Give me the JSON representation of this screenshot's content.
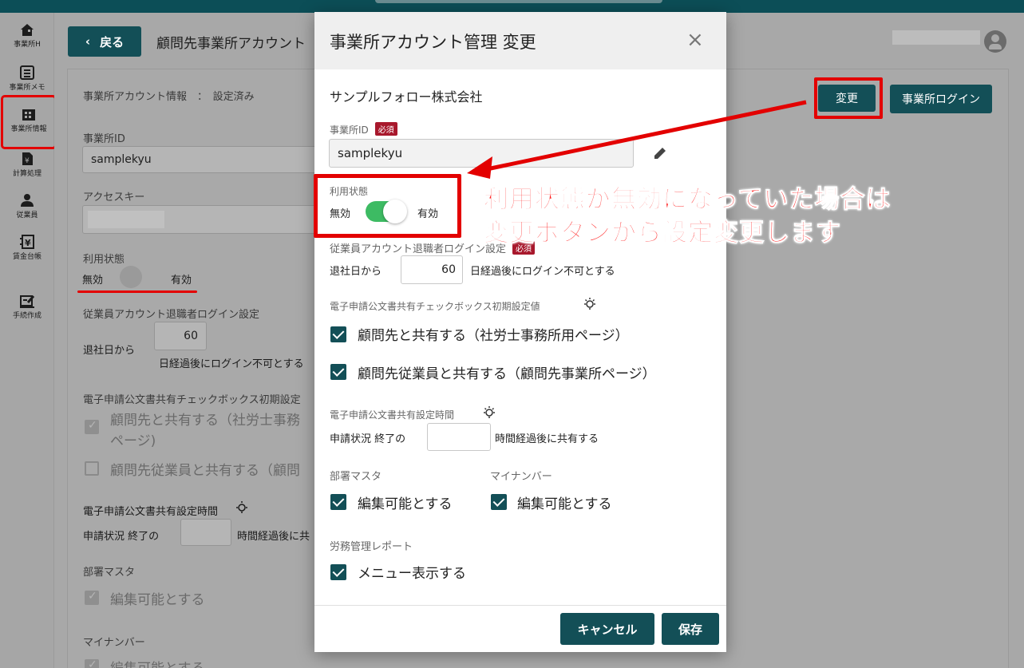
{
  "sidebar": {
    "items": [
      {
        "label": "事業所H",
        "icon": "home-icon"
      },
      {
        "label": "事業所メモ",
        "icon": "memo-icon"
      },
      {
        "label": "事業所情報",
        "icon": "office-building-icon"
      },
      {
        "label": "計算処理",
        "icon": "calculation-doc-icon"
      },
      {
        "label": "従業員",
        "icon": "person-icon"
      },
      {
        "label": "賃金台帳",
        "icon": "yen-ledger-icon"
      },
      {
        "label": "手続作成",
        "icon": "edit-form-icon"
      }
    ]
  },
  "header": {
    "back_label": "戻る",
    "page_title": "顧問先事業所アカウント"
  },
  "background": {
    "account_info_label": "事業所アカウント情報",
    "account_info_sep": "：",
    "account_info_value": "設定済み",
    "office_id_label": "事業所ID",
    "office_id_value": "samplekyu",
    "access_key_label": "アクセスキー",
    "status_label": "利用状態",
    "status_off": "無効",
    "status_on": "有効",
    "retire_label": "従業員アカウント退職者ログイン設定",
    "retire_prefix": "退社日から",
    "retire_days": "60",
    "retire_suffix": "日経過後にログイン不可とする",
    "share_default_label": "電子申請公文書共有チェックボックス初期設定",
    "share_client_line1": "顧問先と共有する（社労士事務",
    "share_client_line2": "ページ)",
    "share_employee": "顧問先従業員と共有する（顧問",
    "share_time_label": "電子申請公文書共有設定時間",
    "share_time_prefix": "申請状況 終了の",
    "share_time_suffix": "時間経過後に共",
    "dept_label": "部署マスタ",
    "dept_editable": "編集可能とする",
    "mynumber_label": "マイナンバー",
    "mynumber_editable": "編集可能とする",
    "change_button": "変更",
    "login_button": "事業所ログイン"
  },
  "modal": {
    "title": "事業所アカウント管理 変更",
    "company": "サンプルフォロー株式会社",
    "office_id_label": "事業所ID",
    "required": "必須",
    "office_id_value": "samplekyu",
    "status_label": "利用状態",
    "status_off": "無効",
    "status_on": "有効",
    "status_enabled": true,
    "retire_label": "従業員アカウント退職者ログイン設定",
    "retire_prefix": "退社日から",
    "retire_days": "60",
    "retire_suffix": "日経過後にログイン不可とする",
    "share_default_label": "電子申請公文書共有チェックボックス初期設定値",
    "share_client": "顧問先と共有する（社労士事務所用ページ）",
    "share_employee": "顧問先従業員と共有する（顧問先事業所ページ）",
    "share_time_label": "電子申請公文書共有設定時間",
    "share_time_prefix": "申請状況 終了の",
    "share_time_value": "",
    "share_time_suffix": "時間経過後に共有する",
    "dept_label": "部署マスタ",
    "dept_editable": "編集可能とする",
    "mynumber_label": "マイナンバー",
    "mynumber_editable": "編集可能とする",
    "report_label": "労務管理レポート",
    "report_menu": "メニュー表示する",
    "cancel_button": "キャンセル",
    "save_button": "保存"
  },
  "annotation": {
    "line1": "利用状態が無効になっていた場合は",
    "line2": "変更ボタンから設定変更します",
    "color": "#ff1f1f"
  }
}
